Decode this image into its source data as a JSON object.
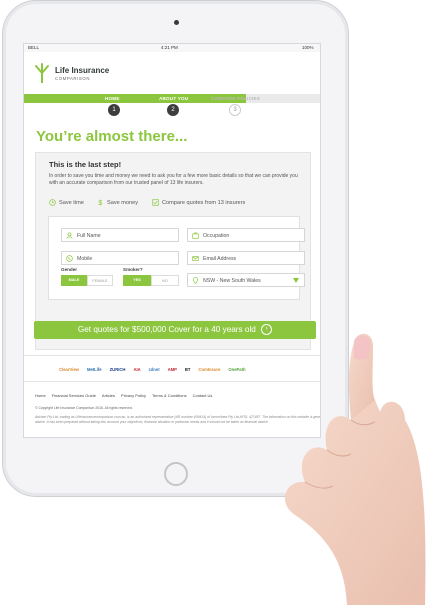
{
  "status_bar": {
    "carrier": "BELL",
    "time": "4:21 PM",
    "battery": "100%"
  },
  "brand": {
    "name": "Life Insurance",
    "tagline": "COMPARISON",
    "color": "#8cc63f"
  },
  "steps": [
    {
      "label": "HOME",
      "number": "1",
      "state": "done"
    },
    {
      "label": "ABOUT YOU",
      "number": "2",
      "state": "current"
    },
    {
      "label": "COMPARE POLICIES",
      "number": "3",
      "state": "upcoming"
    }
  ],
  "headline": "You’re almost there...",
  "card": {
    "title": "This is the last step!",
    "text": "In order to save you time and money we need to ask you for a few more basic details so that we can provide you with an accurate comparison from our trusted panel of 13 life insurers.",
    "benefits": [
      "Save time",
      "Save money",
      "Compare quotes from 13 insurers"
    ]
  },
  "form": {
    "full_name_placeholder": "Full Name",
    "occupation_placeholder": "Occupation",
    "mobile_placeholder": "Mobile",
    "email_placeholder": "Email Address",
    "gender_label": "Gender",
    "gender_options": [
      "MALE",
      "FEMALE"
    ],
    "gender_selected": "MALE",
    "smoker_label": "Smoker?",
    "smoker_options": [
      "YES",
      "NO"
    ],
    "smoker_selected": "YES",
    "state_value": "NSW - New South Wales"
  },
  "cta_label": "Get quotes for $500,000 Cover for a 40 years old",
  "insurers": [
    "ClearView",
    "MetLife",
    "ZURICH",
    "AIA",
    "zdnet",
    "AMP",
    "BT",
    "ComInsure",
    "OnePath"
  ],
  "footer": {
    "links": [
      "Home",
      "Financial Services Guide",
      "Articles",
      "Privacy Policy",
      "Terms & Conditions",
      "Contact Us"
    ],
    "copyright": "© Copyright Life Insurance Comparison 2016. All rights reserved.",
    "disclaimer": "Adviser Pty Ltd, trading as Lifeinsurancecomparison.com.au, is an authorised representative (AR number 409414) of Incomlinea Pty Ltd AFSL 427487. The information on this website is general advice. It has been prepared without taking into account your objectives, financial situation or particular needs and it should not be taken as financial advice."
  }
}
